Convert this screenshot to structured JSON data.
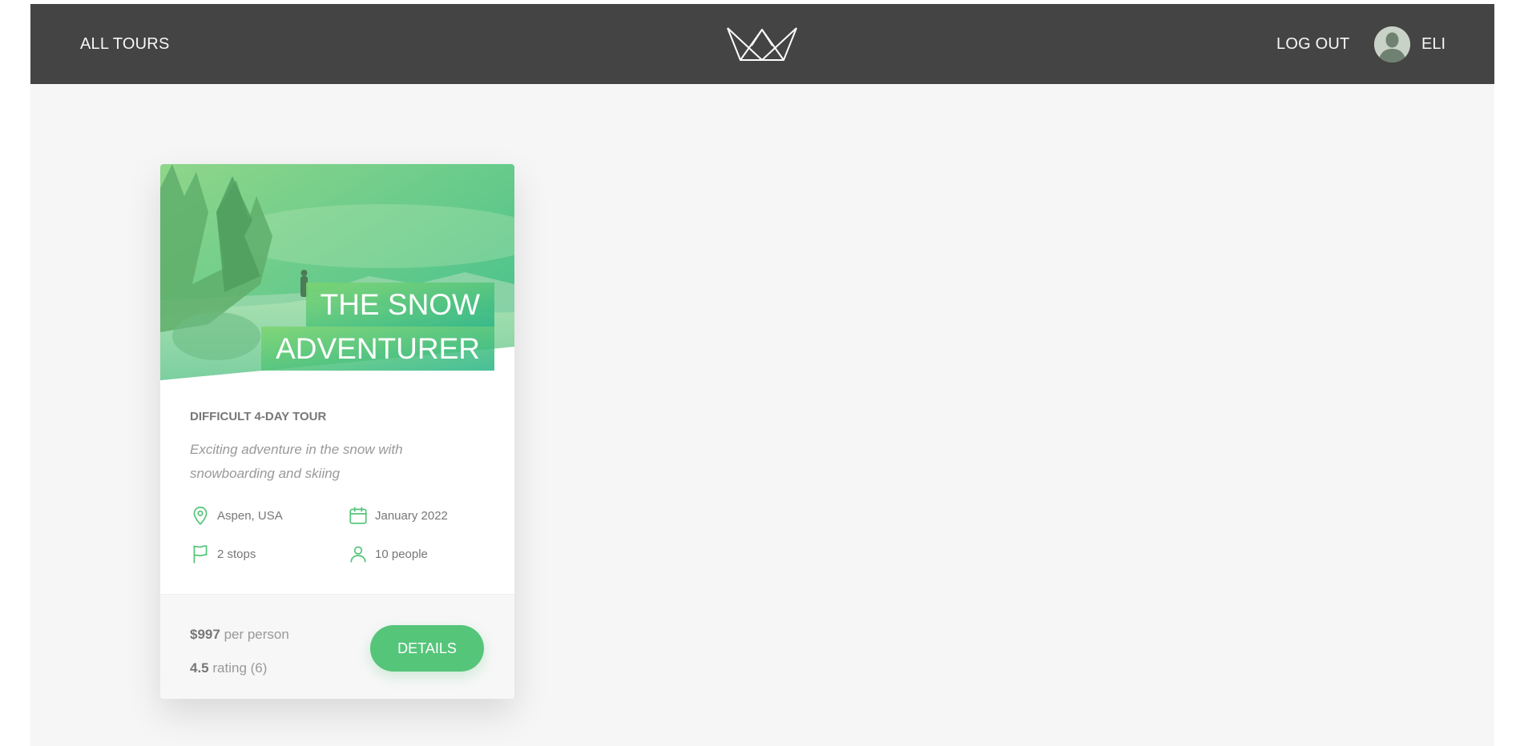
{
  "navbar": {
    "all_tours": "ALL TOURS",
    "logo_icon": "crown-logo-icon",
    "log_out": "LOG OUT",
    "user_name": "ELI",
    "avatar_icon": "user-avatar-icon"
  },
  "card": {
    "heading_line_1": "THE SNOW",
    "heading_line_2": "ADVENTURER",
    "sub_heading": "DIFFICULT 4-DAY TOUR",
    "summary": "Exciting adventure in the snow with snowboarding and skiing",
    "data": [
      {
        "icon": "map-pin-icon",
        "text": "Aspen, USA"
      },
      {
        "icon": "calendar-icon",
        "text": "January 2022"
      },
      {
        "icon": "flag-icon",
        "text": "2 stops"
      },
      {
        "icon": "user-icon",
        "text": "10 people"
      }
    ],
    "price_value": "$997",
    "price_unit": "per person",
    "rating_value": "4.5",
    "rating_text": "rating (6)",
    "details_button": "DETAILS"
  },
  "colors": {
    "navbar_bg": "#444444",
    "page_bg": "#f6f6f6",
    "accent": "#55c57a",
    "accent_dark": "#28b485"
  }
}
